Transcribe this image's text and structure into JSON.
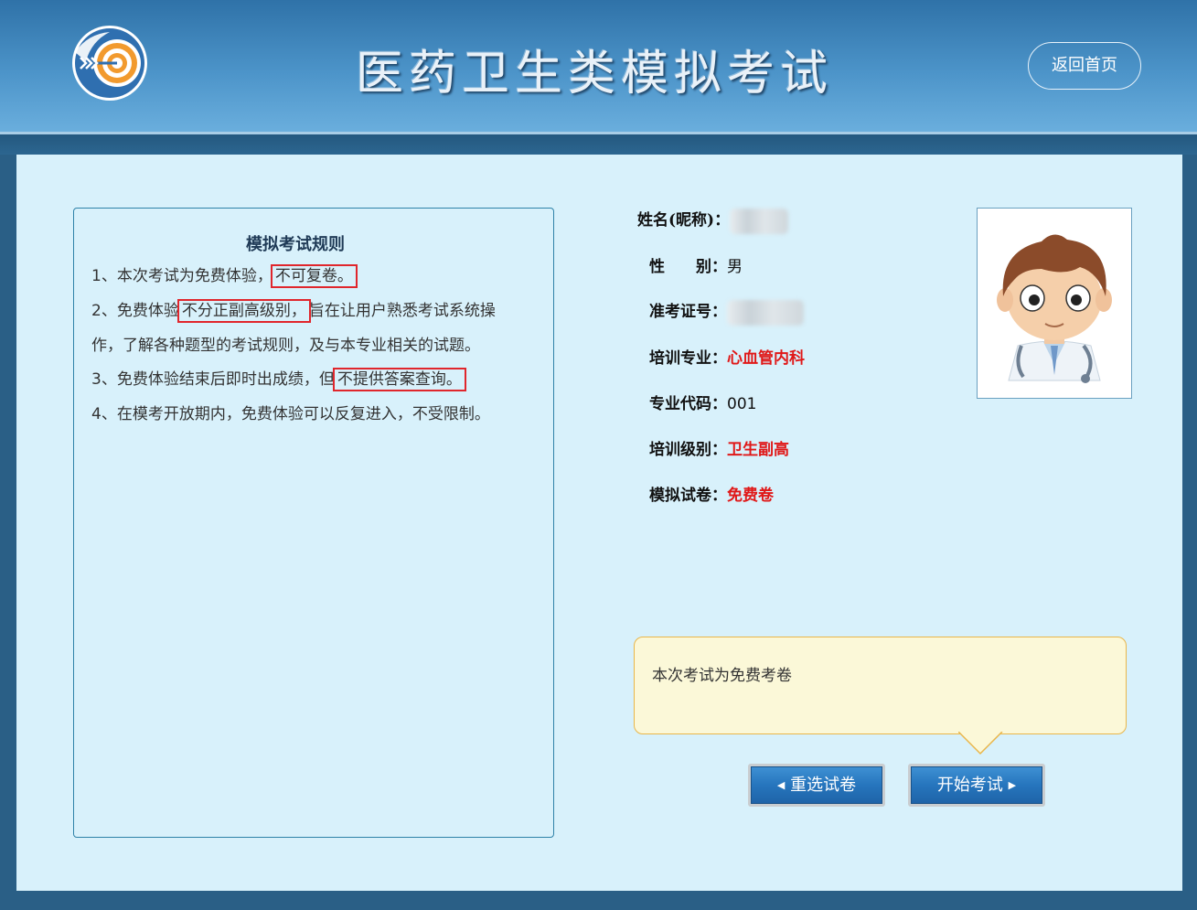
{
  "header": {
    "title": "医药卫生类模拟考试",
    "home_button": "返回首页"
  },
  "rules": {
    "title": "模拟考试规则",
    "items": [
      {
        "before": "1、本次考试为免费体验，",
        "highlight": "不可复卷。",
        "after": ""
      },
      {
        "before": "2、免费体验",
        "highlight": "不分正副高级别，",
        "after": "旨在让用户熟悉考试系统操"
      },
      {
        "before": "作，了解各种题型的考试规则，及与本专业相关的试题。",
        "highlight": "",
        "after": ""
      },
      {
        "before": "3、免费体验结束后即时出成绩，但",
        "highlight": "不提供答案查询。",
        "after": ""
      },
      {
        "before": "4、在模考开放期内，免费体验可以反复进入，不受限制。",
        "highlight": "",
        "after": ""
      }
    ]
  },
  "candidate": {
    "name_label": "姓名(昵称)：",
    "gender_label": "性　　别：",
    "gender_value": "男",
    "ticket_label": "准考证号：",
    "major_label": "培训专业：",
    "major_value": "心血管内科",
    "code_label": "专业代码：",
    "code_value": "001",
    "level_label": "培训级别：",
    "level_value": "卫生副高",
    "paper_label": "模拟试卷：",
    "paper_value": "免费卷"
  },
  "notice": {
    "text": "本次考试为免费考卷"
  },
  "buttons": {
    "reselect": "重选试卷",
    "start": "开始考试"
  },
  "colors": {
    "header_blue": "#4c94c9",
    "panel_bg": "#d8f1fb",
    "highlight_red": "#e0262c",
    "value_red": "#e01818",
    "button_blue": "#2675bd"
  }
}
